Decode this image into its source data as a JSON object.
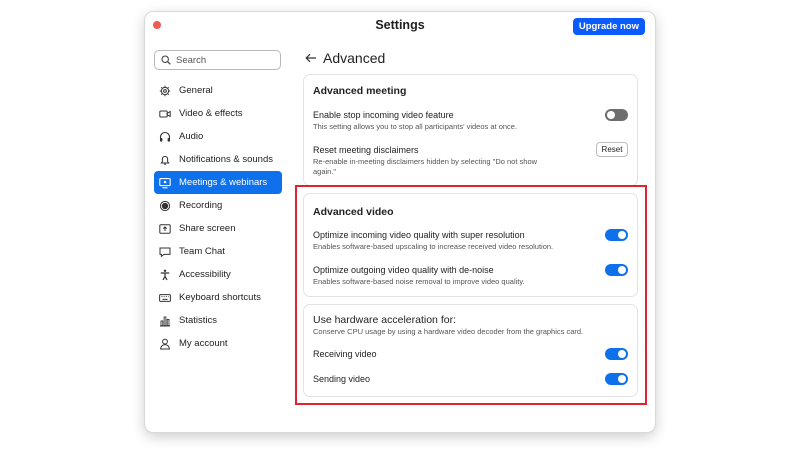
{
  "window": {
    "title": "Settings",
    "upgrade_label": "Upgrade now"
  },
  "sidebar": {
    "search_placeholder": "Search",
    "items": [
      {
        "label": "General",
        "icon": "gear-icon",
        "active": false
      },
      {
        "label": "Video & effects",
        "icon": "video-icon",
        "active": false
      },
      {
        "label": "Audio",
        "icon": "headphones-icon",
        "active": false
      },
      {
        "label": "Notifications & sounds",
        "icon": "bell-icon",
        "active": false
      },
      {
        "label": "Meetings & webinars",
        "icon": "meetings-icon",
        "active": true
      },
      {
        "label": "Recording",
        "icon": "record-icon",
        "active": false
      },
      {
        "label": "Share screen",
        "icon": "share-screen-icon",
        "active": false
      },
      {
        "label": "Team Chat",
        "icon": "chat-icon",
        "active": false
      },
      {
        "label": "Accessibility",
        "icon": "accessibility-icon",
        "active": false
      },
      {
        "label": "Keyboard shortcuts",
        "icon": "keyboard-icon",
        "active": false
      },
      {
        "label": "Statistics",
        "icon": "statistics-icon",
        "active": false
      },
      {
        "label": "My account",
        "icon": "person-icon",
        "active": false
      }
    ]
  },
  "main": {
    "page_title": "Advanced",
    "advanced_meeting": {
      "title": "Advanced meeting",
      "stop_video": {
        "title": "Enable stop incoming video feature",
        "desc": "This setting allows you to stop all participants' videos at once.",
        "enabled": false
      },
      "reset_disclaimers": {
        "title": "Reset meeting disclaimers",
        "desc_line1": "Re-enable in-meeting disclaimers hidden by selecting \"Do not show",
        "desc_line2": "again.\"",
        "button_label": "Reset"
      }
    },
    "advanced_video": {
      "title": "Advanced video",
      "super_resolution": {
        "title": "Optimize incoming video quality with super resolution",
        "desc": "Enables software-based upscaling to increase received video resolution.",
        "enabled": true
      },
      "denoise": {
        "title": "Optimize outgoing video quality with de-noise",
        "desc": "Enables software-based noise removal to improve video quality.",
        "enabled": true
      }
    },
    "hardware_acceleration": {
      "title": "Use hardware acceleration for:",
      "desc": "Conserve CPU usage by using a hardware video decoder from the graphics card.",
      "receiving": {
        "label": "Receiving video",
        "enabled": true
      },
      "sending": {
        "label": "Sending video",
        "enabled": true
      }
    }
  },
  "colors": {
    "accent": "#0e71eb",
    "upgrade": "#0b5cff",
    "highlight": "#e0232d",
    "close_dot": "#ee5b52"
  }
}
